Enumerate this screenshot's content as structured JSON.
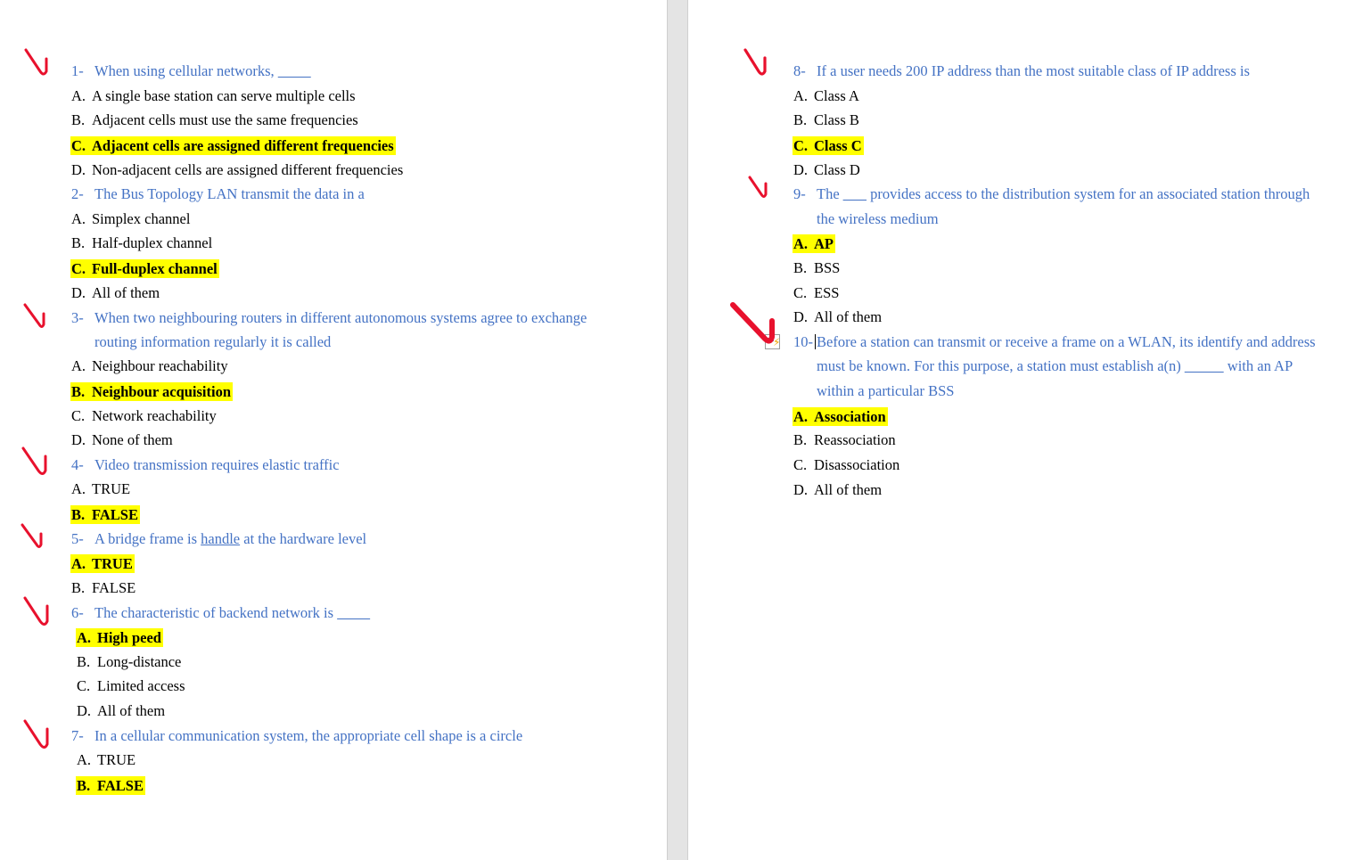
{
  "document": {
    "type": "scanned-exam-answer-key",
    "page_count": 2,
    "colors": {
      "question_text": "#4472C4",
      "option_text": "#000000",
      "highlight": "#FFFF00",
      "check_mark": "#E8112D",
      "page_gap": "#E4E4E4"
    }
  },
  "left_page": {
    "questions": [
      {
        "number": "1-",
        "text": "When using cellular networks, ",
        "has_blank": true,
        "options": [
          {
            "letter": "A.",
            "text": "A single base station can serve multiple cells",
            "highlighted": false
          },
          {
            "letter": "B.",
            "text": "Adjacent cells must use the same frequencies",
            "highlighted": false
          },
          {
            "letter": "C.",
            "text": "Adjacent cells are assigned different frequencies",
            "highlighted": true
          },
          {
            "letter": "D.",
            "text": "Non-adjacent cells are assigned different frequencies",
            "highlighted": false
          }
        ]
      },
      {
        "number": "2-",
        "text": "The Bus Topology LAN transmit the data in a",
        "has_blank": false,
        "options": [
          {
            "letter": "A.",
            "text": "Simplex channel",
            "highlighted": false
          },
          {
            "letter": "B.",
            "text": "Half-duplex channel",
            "highlighted": false
          },
          {
            "letter": "C.",
            "text": "Full-duplex channel",
            "highlighted": true
          },
          {
            "letter": "D.",
            "text": "All of them",
            "highlighted": false
          }
        ]
      },
      {
        "number": "3-",
        "text": "When two neighbouring routers in different autonomous systems agree to exchange",
        "text_line2": "routing information regularly it is called",
        "has_blank": false,
        "options": [
          {
            "letter": "A.",
            "text": "Neighbour reachability",
            "highlighted": false
          },
          {
            "letter": "B.",
            "text": "Neighbour acquisition",
            "highlighted": true
          },
          {
            "letter": "C.",
            "text": "Network reachability",
            "highlighted": false
          },
          {
            "letter": "D.",
            "text": "None of them",
            "highlighted": false
          }
        ]
      },
      {
        "number": "4-",
        "text": "Video transmission requires elastic traffic",
        "has_blank": false,
        "options": [
          {
            "letter": "A.",
            "text": "TRUE",
            "highlighted": false
          },
          {
            "letter": "B.",
            "text": "FALSE",
            "highlighted": true
          }
        ]
      },
      {
        "number": "5-",
        "text_before_underline": "A bridge frame is ",
        "underlined_word": "handle",
        "text_after_underline": " at the hardware level",
        "has_blank": false,
        "options": [
          {
            "letter": "A.",
            "text": "TRUE",
            "highlighted": true
          },
          {
            "letter": "B.",
            "text": "FALSE",
            "highlighted": false
          }
        ]
      },
      {
        "number": "6-",
        "text": "The characteristic of backend network is ",
        "has_blank": true,
        "options": [
          {
            "letter": "A.",
            "text": "High peed",
            "highlighted": true
          },
          {
            "letter": "B.",
            "text": "Long-distance",
            "highlighted": false
          },
          {
            "letter": "C.",
            "text": "Limited access",
            "highlighted": false
          },
          {
            "letter": "D.",
            "text": "All of them",
            "highlighted": false
          }
        ]
      },
      {
        "number": "7-",
        "text": "In a cellular communication system, the appropriate cell shape is a circle",
        "has_blank": false,
        "options": [
          {
            "letter": "A.",
            "text": "TRUE",
            "highlighted": false
          },
          {
            "letter": "B.",
            "text": "FALSE",
            "highlighted": true
          }
        ]
      }
    ]
  },
  "right_page": {
    "questions": [
      {
        "number": "8-",
        "text": "If a user needs 200 IP address than the most suitable class of IP address is",
        "has_blank": false,
        "options": [
          {
            "letter": "A.",
            "text": "Class A",
            "highlighted": false
          },
          {
            "letter": "B.",
            "text": "Class B",
            "highlighted": false
          },
          {
            "letter": "C.",
            "text": "Class C",
            "highlighted": true
          },
          {
            "letter": "D.",
            "text": "Class D",
            "highlighted": false
          }
        ]
      },
      {
        "number": "9-",
        "text_part1": "The ",
        "blank": "___",
        "text_part2": " provides access to the distribution system for an associated station through",
        "text_line2": "the wireless medium",
        "options": [
          {
            "letter": "A.",
            "text": "AP",
            "highlighted": true
          },
          {
            "letter": "B.",
            "text": "BSS",
            "highlighted": false
          },
          {
            "letter": "C.",
            "text": "ESS",
            "highlighted": false
          },
          {
            "letter": "D.",
            "text": "All of them",
            "highlighted": false
          }
        ]
      },
      {
        "number": "10-",
        "text": "Before a station can transmit or receive a frame on a WLAN, its identify and address",
        "text_line2_part1": "must be known. For this purpose, a station must establish a(n) ",
        "text_line2_blank": "_____",
        "text_line2_part2": " with an AP",
        "text_line3": "within a particular BSS",
        "options": [
          {
            "letter": "A.",
            "text": "Association",
            "highlighted": true
          },
          {
            "letter": "B.",
            "text": "Reassociation",
            "highlighted": false
          },
          {
            "letter": "C.",
            "text": "Disassociation",
            "highlighted": false
          },
          {
            "letter": "D.",
            "text": "All of them",
            "highlighted": false
          }
        ]
      }
    ],
    "smart_tag": {
      "name": "autocorrect-options-icon",
      "glyph": "⚡"
    }
  }
}
